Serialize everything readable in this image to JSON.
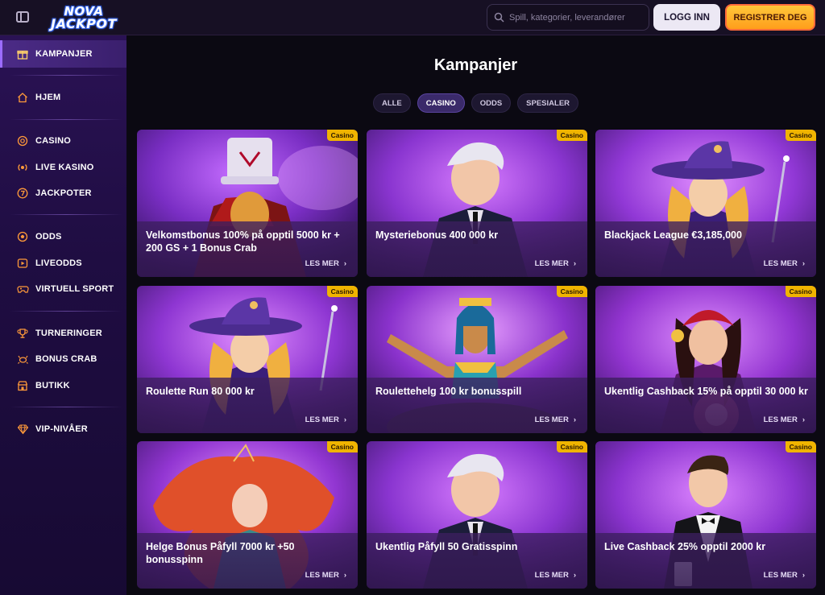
{
  "header": {
    "logo_line1": "NOVA",
    "logo_line2": "JACKPOT",
    "search_placeholder": "Spill, kategorier, leverandører",
    "login_label": "LOGG INN",
    "register_label": "REGISTRER DEG"
  },
  "sidebar": {
    "items": [
      {
        "label": "KAMPANJER",
        "icon": "gift-icon"
      },
      {
        "label": "HJEM",
        "icon": "home-icon"
      },
      {
        "label": "CASINO",
        "icon": "casino-chip-icon"
      },
      {
        "label": "LIVE KASINO",
        "icon": "live-icon"
      },
      {
        "label": "JACKPOTER",
        "icon": "seven-icon"
      },
      {
        "label": "ODDS",
        "icon": "football-icon"
      },
      {
        "label": "LIVEODDS",
        "icon": "play-box-icon"
      },
      {
        "label": "VIRTUELL SPORT",
        "icon": "gamepad-icon"
      },
      {
        "label": "TURNERINGER",
        "icon": "trophy-icon"
      },
      {
        "label": "BONUS CRAB",
        "icon": "crab-icon"
      },
      {
        "label": "BUTIKK",
        "icon": "shop-icon"
      },
      {
        "label": "VIP-NIVÅER",
        "icon": "diamond-icon"
      }
    ]
  },
  "main": {
    "title": "Kampanjer",
    "filters": [
      "ALLE",
      "CASINO",
      "ODDS",
      "SPESIALER"
    ],
    "selected_filter": "CASINO",
    "cards": [
      {
        "title": "Velkomstbonus 100% på opptil 5000 kr + 200 GS + 1 Bonus Crab",
        "tag": "Casino",
        "more": "LES MER"
      },
      {
        "title": "Mysteriebonus 400 000 kr",
        "tag": "Casino",
        "more": "LES MER"
      },
      {
        "title": "Blackjack League €3,185,000",
        "tag": "Casino",
        "more": "LES MER"
      },
      {
        "title": "Roulette Run 80 000 kr",
        "tag": "Casino",
        "more": "LES MER"
      },
      {
        "title": "Roulettehelg 100 kr bonusspill",
        "tag": "Casino",
        "more": "LES MER"
      },
      {
        "title": "Ukentlig Cashback 15% på opptil 30 000 kr",
        "tag": "Casino",
        "more": "LES MER"
      },
      {
        "title": "Helge Bonus Påfyll 7000 kr +50 bonusspinn",
        "tag": "Casino",
        "more": "LES MER"
      },
      {
        "title": "Ukentlig Påfyll 50 Gratisspinn",
        "tag": "Casino",
        "more": "LES MER"
      },
      {
        "title": "Live Cashback 25% opptil 2000 kr",
        "tag": "Casino",
        "more": "LES MER"
      }
    ]
  },
  "colors": {
    "sidebar_bg": "#1f0d42",
    "accent_purple": "#9b6cff",
    "register_yellow": "#ffb52a",
    "tag_yellow": "#f0b400"
  }
}
